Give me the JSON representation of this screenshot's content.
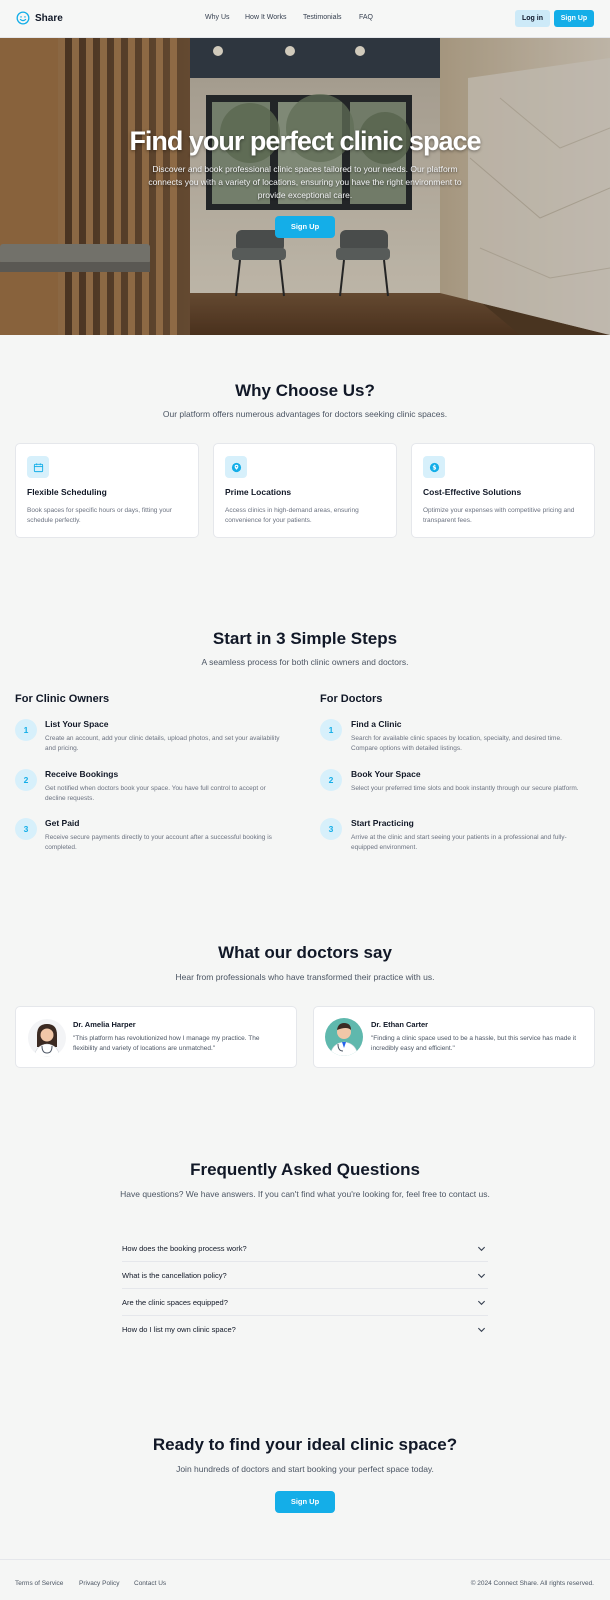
{
  "header": {
    "brand": "Share",
    "nav": [
      "Why Us",
      "How It Works",
      "Testimonials",
      "FAQ"
    ],
    "login_label": "Log in",
    "signup_label": "Sign Up"
  },
  "hero": {
    "title": "Find your perfect clinic space",
    "subtitle": "Discover and book professional clinic spaces tailored to your needs. Our platform connects you with a variety of locations, ensuring you have the right environment to provide exceptional care.",
    "cta_label": "Sign Up"
  },
  "why": {
    "title": "Why Choose Us?",
    "subtitle": "Our platform offers numerous advantages for doctors seeking clinic spaces.",
    "cards": [
      {
        "icon": "calendar-icon",
        "title": "Flexible Scheduling",
        "desc": "Book spaces for specific hours or days, fitting your schedule perfectly."
      },
      {
        "icon": "location-icon",
        "title": "Prime Locations",
        "desc": "Access clinics in high-demand areas, ensuring convenience for your patients."
      },
      {
        "icon": "dollar-icon",
        "title": "Cost-Effective Solutions",
        "desc": "Optimize your expenses with competitive pricing and transparent fees."
      }
    ]
  },
  "steps": {
    "title": "Start in 3 Simple Steps",
    "subtitle": "A seamless process for both clinic owners and doctors.",
    "owners": {
      "title": "For Clinic Owners",
      "items": [
        {
          "num": "1",
          "title": "List Your Space",
          "desc": "Create an account, add your clinic details, upload photos, and set your availability and pricing."
        },
        {
          "num": "2",
          "title": "Receive Bookings",
          "desc": "Get notified when doctors book your space. You have full control to accept or decline requests."
        },
        {
          "num": "3",
          "title": "Get Paid",
          "desc": "Receive secure payments directly to your account after a successful booking is completed."
        }
      ]
    },
    "doctors": {
      "title": "For Doctors",
      "items": [
        {
          "num": "1",
          "title": "Find a Clinic",
          "desc": "Search for available clinic spaces by location, specialty, and desired time. Compare options with detailed listings."
        },
        {
          "num": "2",
          "title": "Book Your Space",
          "desc": "Select your preferred time slots and book instantly through our secure platform."
        },
        {
          "num": "3",
          "title": "Start Practicing",
          "desc": "Arrive at the clinic and start seeing your patients in a professional and fully-equipped environment."
        }
      ]
    }
  },
  "testimonials": {
    "title": "What our doctors say",
    "subtitle": "Hear from professionals who have transformed their practice with us.",
    "items": [
      {
        "name": "Dr. Amelia Harper",
        "quote": "\"This platform has revolutionized how I manage my practice. The flexibility and variety of locations are unmatched.\""
      },
      {
        "name": "Dr. Ethan Carter",
        "quote": "\"Finding a clinic space used to be a hassle, but this service has made it incredibly easy and efficient.\""
      }
    ]
  },
  "faq": {
    "title": "Frequently Asked Questions",
    "subtitle": "Have questions? We have answers. If you can't find what you're looking for, feel free to contact us.",
    "questions": [
      "How does the booking process work?",
      "What is the cancellation policy?",
      "Are the clinic spaces equipped?",
      "How do I list my own clinic space?"
    ]
  },
  "cta": {
    "title": "Ready to find your ideal clinic space?",
    "subtitle": "Join hundreds of doctors and start booking your perfect space today.",
    "button_label": "Sign Up"
  },
  "footer": {
    "links": [
      "Terms of Service",
      "Privacy Policy",
      "Contact Us"
    ],
    "copyright": "© 2024 Connect Share. All rights reserved."
  },
  "colors": {
    "accent": "#14aee8",
    "accent_light": "#d7f0fb",
    "background": "#f5f6f5"
  }
}
